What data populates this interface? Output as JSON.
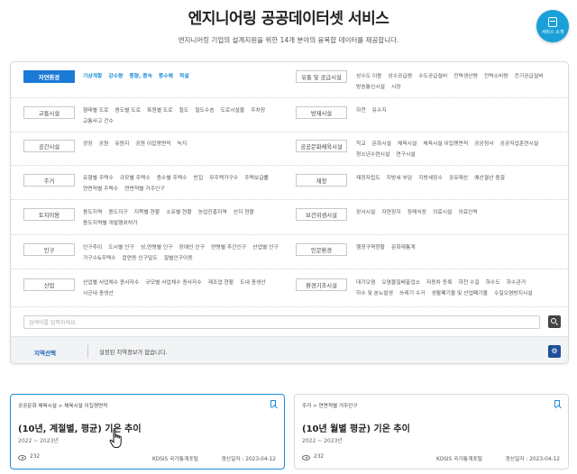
{
  "header": {
    "title": "엔지니어링 공공데이터셋 서비스",
    "subtitle": "엔지니어링 기업의 설계지원을 위한 14개 분야의 융복합 데이터를 제공합니다.",
    "intro_button": "서비스 소개"
  },
  "categories": [
    {
      "label": "자연환경",
      "active": true,
      "items": [
        "기상개황",
        "강수량",
        "풍향, 풍속",
        "풍수해",
        "적설"
      ]
    },
    {
      "label": "유통 및 공급시설",
      "items": [
        "상수도 이용",
        "상수공급량",
        "수도공급설비",
        "전력생산량",
        "전력소비량",
        "전기공급설비",
        "방송통신시설",
        "시장"
      ]
    },
    {
      "label": "교통시설",
      "items": [
        "형태별 도로",
        "용도별 도로",
        "폭원별 도로",
        "철도",
        "철도수송",
        "도로시설물",
        "주차장",
        "교통사고 건수"
      ]
    },
    {
      "label": "방재시설",
      "items": [
        "하천",
        "유수지"
      ]
    },
    {
      "label": "공간시설",
      "items": [
        "광장",
        "공원",
        "유원지",
        "공원 이집쟁면적",
        "녹지"
      ]
    },
    {
      "label": "공공문화체육시설",
      "items": [
        "학교",
        "문화시설",
        "체육시설",
        "체육시설 이집쟁면적",
        "공공청사",
        "공공직업훈련시설",
        "청소년수련시설",
        "연구시설"
      ]
    },
    {
      "label": "주거",
      "items": [
        "유형별 주택수",
        "규모별 주택수",
        "층수별 주택수",
        "빈집",
        "무주택가구수",
        "주택보급률",
        "연면적별 주택수",
        "연면적별 거주인구"
      ]
    },
    {
      "label": "재정",
      "items": [
        "재정자립도",
        "지방세 부담",
        "지방세징수",
        "공유재산",
        "예산결산 총괄"
      ]
    },
    {
      "label": "토지이용",
      "items": [
        "용도지역",
        "용도지구",
        "지목별 현황",
        "소유별 현황",
        "농업진흥지역",
        "산지 현황",
        "용도지역별 개발행위허가"
      ]
    },
    {
      "label": "보건위생시설",
      "items": [
        "장사시설",
        "자연장지",
        "장례식장",
        "의료시설",
        "의료인력"
      ]
    },
    {
      "label": "인구",
      "items": [
        "인구추이",
        "도시별 인구",
        "성,연령별 인구",
        "장애인 인구",
        "연령별 추간인구",
        "산업별 인구",
        "가구수&주택수",
        "읍면동 인구밀도",
        "필별인구이동"
      ]
    },
    {
      "label": "인문환경",
      "items": [
        "행정구역현황",
        "문화재통계"
      ]
    },
    {
      "label": "산업",
      "items": [
        "산업별 사업체수 종사자수",
        "규모별 사업체수 종사자수",
        "제조업 현황",
        "도내 총생산",
        "시군내 총생산"
      ]
    },
    {
      "label": "환경기초시설",
      "items": [
        "대기오염",
        "오염물질배출업소",
        "자동차 등록",
        "하천 수질",
        "하수도",
        "하수관거",
        "하수 및 분뇨발생",
        "쓰레기 수거",
        "생활폐기물 및 산업폐기물",
        "수질오염방지시설"
      ]
    }
  ],
  "search": {
    "placeholder": "검색어를 입력하세요."
  },
  "region": {
    "title": "지역선택",
    "message": "설정된 지역정보가 없습니다."
  },
  "cards": [
    {
      "breadcrumb": "공공문화 체육시설 > 체육시설 이집쟁면적",
      "title": "(10년, 계절별, 평균) 기온 추이",
      "period": "2022 ~ 2023년",
      "views": "232",
      "source": "KOSIS 국가통계포털",
      "updated": "갱신일자 : 2023-04-12",
      "selected": true
    },
    {
      "breadcrumb": "주거 > 연면적별 거주인구",
      "title": "(10년 월별 평균) 기온 추이",
      "period": "2022 ~ 2023년",
      "views": "232",
      "source": "KOSIS 국가통계포털",
      "updated": "갱신일자 : 2023-04-12",
      "selected": false
    }
  ],
  "colors": {
    "accent": "#1a7ad6",
    "intro_button": "#1aa0d8",
    "settings_button": "#1f4f9c"
  },
  "icons": {
    "intro": "book-icon",
    "search": "search-icon",
    "settings": "gear-icon",
    "bookmark": "bookmark-icon",
    "views": "eye-icon",
    "cursor": "hand-pointer-icon"
  }
}
